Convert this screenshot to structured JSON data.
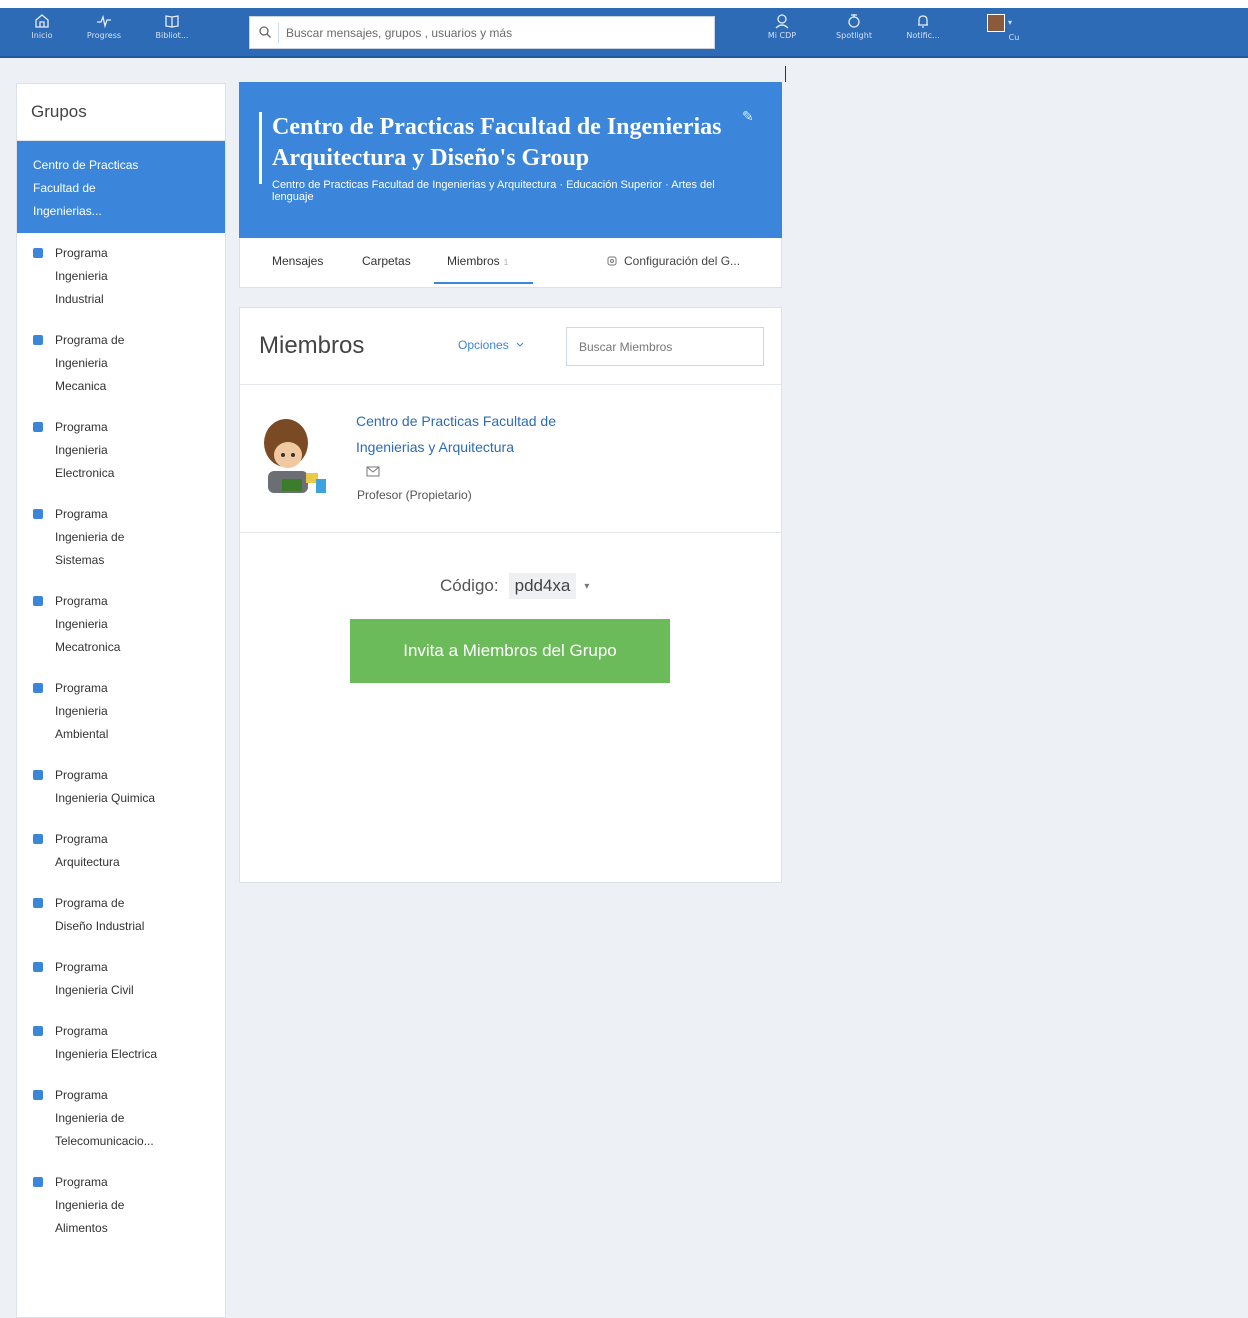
{
  "nav": {
    "left": [
      {
        "label": "Inicio",
        "icon": "home-icon"
      },
      {
        "label": "Progress",
        "icon": "pulse-icon"
      },
      {
        "label": "Bibliot...",
        "icon": "book-icon"
      }
    ],
    "search_placeholder": "Buscar mensajes, grupos , usuarios y más",
    "right": [
      {
        "label": "Mi CDP",
        "icon": "user-circle-icon"
      },
      {
        "label": "Spotlight",
        "icon": "apple-icon"
      },
      {
        "label": "Notific...",
        "icon": "bell-icon"
      },
      {
        "label": "Cu",
        "icon": "avatar"
      }
    ]
  },
  "sidebar": {
    "title": "Grupos",
    "active": "Centro de Practicas\nFacultad de\nIngenierias...",
    "items": [
      "Programa\nIngenieria\nIndustrial",
      "Programa de\nIngenieria\nMecanica",
      "Programa\nIngenieria\nElectronica",
      "Programa\nIngenieria de\nSistemas",
      "Programa\nIngenieria\nMecatronica",
      "Programa\nIngenieria\nAmbiental",
      "Programa\nIngenieria Quimica",
      "Programa\nArquitectura",
      "Programa de\nDiseño Industrial",
      "Programa\nIngenieria Civil",
      "Programa\nIngenieria Electrica",
      "Programa\nIngenieria de\nTelecomunicacio...",
      "Programa\nIngenieria de\nAlimentos"
    ]
  },
  "group": {
    "title": "Centro de Practicas Facultad de Ingenierias Arquitectura y Diseño's Group",
    "subtitle": "Centro de Practicas Facultad de Ingenierias y Arquitectura · Educación Superior · Artes del lenguaje",
    "tabs": {
      "messages": "Mensajes",
      "folders": "Carpetas",
      "members": "Miembros",
      "members_count": "1",
      "settings": "Configuración del G..."
    }
  },
  "members": {
    "title": "Miembros",
    "options": "Opciones",
    "search_placeholder": "Buscar Miembros",
    "list": [
      {
        "name": "Centro de Practicas Facultad de Ingenierias y Arquitectura",
        "role": "Profesor (Propietario)"
      }
    ],
    "code_label": "Código:",
    "code_value": "pdd4xa",
    "invite_button": "Invita a Miembros del Grupo"
  },
  "colors": {
    "nav": "#2d6bb7",
    "accent": "#3b86db",
    "invite": "#6cbb5a"
  }
}
